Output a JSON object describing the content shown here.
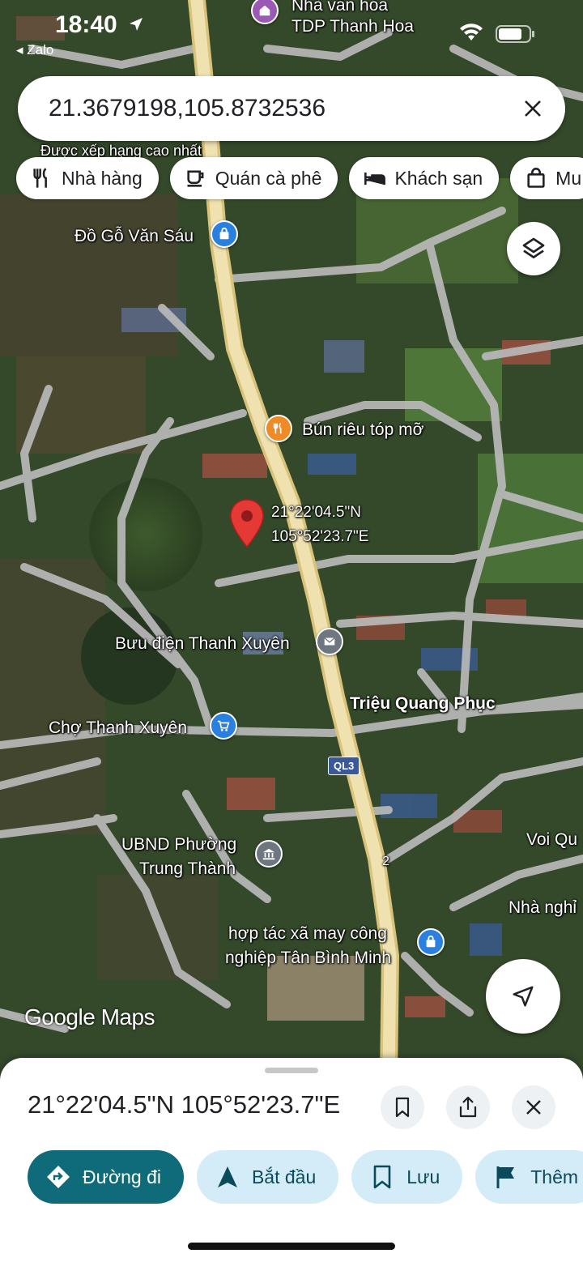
{
  "status_bar": {
    "time": "18:40",
    "back_app": "◂ Zalo"
  },
  "search": {
    "query": "21.3679198,105.8732536"
  },
  "filter_chips": [
    {
      "label": "Nhà hàng",
      "icon": "restaurant-icon"
    },
    {
      "label": "Quán cà phê",
      "icon": "coffee-icon"
    },
    {
      "label": "Khách sạn",
      "icon": "hotel-icon"
    },
    {
      "label": "Mu",
      "icon": "shopping-icon"
    }
  ],
  "map": {
    "labels": {
      "top_poi_1": "Nhà văn hóa",
      "top_poi_2": "TDP Thanh Hoa",
      "ranking": "Được xếp hạng cao nhất",
      "do_go": "Đồ Gỗ Văn Sáu",
      "bun_rieu": "Bún riêu tóp mỡ",
      "pin_lat": "21°22'04.5\"N",
      "pin_lng": "105°52'23.7\"E",
      "buu_dien": "Bưu điện Thanh Xuyên",
      "trieu_quang_phuc": "Triệu Quang Phục",
      "cho": "Chợ Thanh Xuyên",
      "road_badge": "QL3",
      "ubnd_1": "UBND Phường",
      "ubnd_2": "Trung Thành",
      "voi": "Voi Qu",
      "nha_nghi": "Nhà nghỉ",
      "htx_1": "hợp tác xã may công",
      "htx_2": "nghiệp Tân Bình Minh",
      "road_num": "2"
    },
    "attribution": "Google Maps"
  },
  "sheet": {
    "title": "21°22'04.5\"N 105°52'23.7\"E",
    "actions": [
      {
        "label": "Đường đi",
        "icon": "directions-icon"
      },
      {
        "label": "Bắt đầu",
        "icon": "navigation-arrow-icon"
      },
      {
        "label": "Lưu",
        "icon": "bookmark-icon"
      },
      {
        "label": "Thêm",
        "icon": "flag-icon"
      }
    ]
  },
  "colors": {
    "primary_action": "#0f6b79",
    "secondary_action": "#d3ecf7",
    "pin": "#e53935",
    "road_major": "#e8d69a",
    "road_minor": "#b8b8b8",
    "poi_orange": "#f08a24",
    "poi_blue": "#2a80e0",
    "poi_gray": "#6e7780",
    "poi_purple": "#9b59b6"
  }
}
